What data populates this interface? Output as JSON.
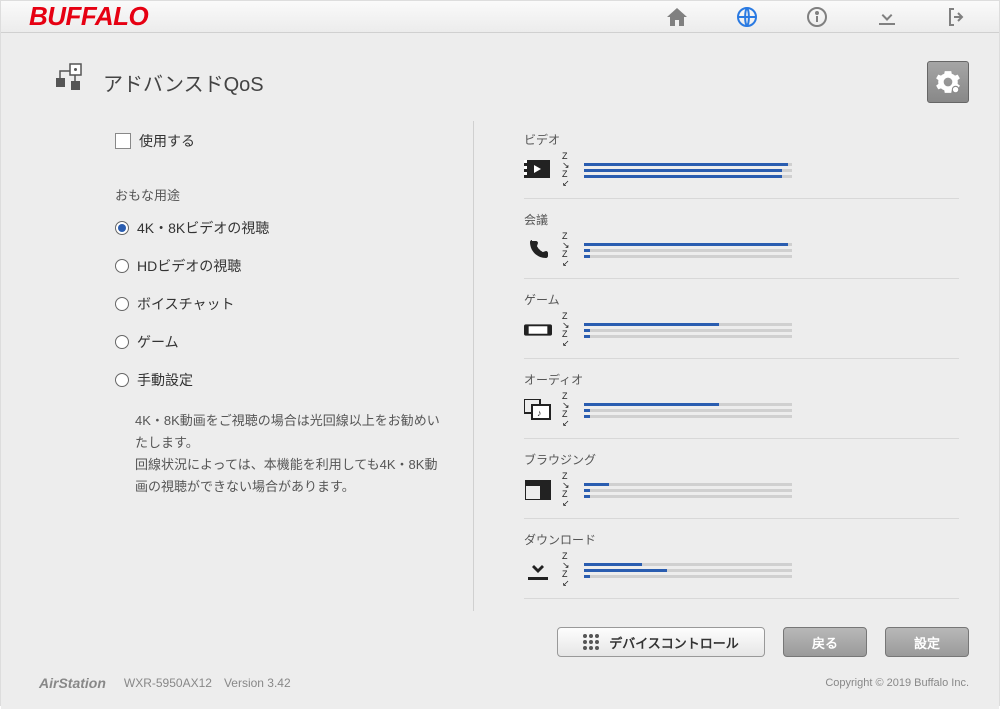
{
  "brand": "BUFFALO",
  "page": {
    "title": "アドバンスドQoS"
  },
  "enable": {
    "label": "使用する",
    "checked": false
  },
  "usage": {
    "heading": "おもな用途",
    "options": [
      {
        "label": "4K・8Kビデオの視聴",
        "selected": true
      },
      {
        "label": "HDビデオの視聴",
        "selected": false
      },
      {
        "label": "ボイスチャット",
        "selected": false
      },
      {
        "label": "ゲーム",
        "selected": false
      },
      {
        "label": "手動設定",
        "selected": false
      }
    ]
  },
  "note": "4K・8K動画をご視聴の場合は光回線以上をお勧めいたします。\n回線状況によっては、本機能を利用しても4K・8K動画の視聴ができない場合があります。",
  "categories": [
    {
      "name": "ビデオ",
      "icon": "video",
      "bars": [
        98,
        95,
        95
      ]
    },
    {
      "name": "会議",
      "icon": "phone",
      "bars": [
        98,
        3,
        3
      ]
    },
    {
      "name": "ゲーム",
      "icon": "game",
      "bars": [
        65,
        3,
        3
      ]
    },
    {
      "name": "オーディオ",
      "icon": "audio",
      "bars": [
        65,
        3,
        3
      ]
    },
    {
      "name": "ブラウジング",
      "icon": "browse",
      "bars": [
        12,
        3,
        3
      ]
    },
    {
      "name": "ダウンロード",
      "icon": "download",
      "bars": [
        28,
        40,
        3
      ]
    }
  ],
  "buttons": {
    "device": "デバイスコントロール",
    "back": "戻る",
    "apply": "設定"
  },
  "footer": {
    "airstation": "AirStation",
    "model": "WXR-5950AX12",
    "version": "Version 3.42",
    "copyright": "Copyright © 2019 Buffalo Inc."
  }
}
